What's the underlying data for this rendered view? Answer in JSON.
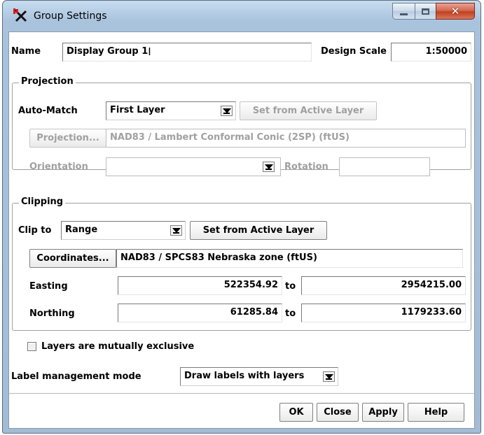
{
  "window": {
    "title": "Group Settings"
  },
  "name_row": {
    "name_label": "Name",
    "name_value": "Display Group 1",
    "design_scale_label": "Design Scale",
    "design_scale_value": "1:50000"
  },
  "projection": {
    "title": "Projection",
    "auto_match_label": "Auto-Match",
    "auto_match_value": "First Layer",
    "set_from_active_label": "Set from Active Layer",
    "projection_button": "Projection...",
    "projection_value": "NAD83 / Lambert Conformal Conic (2SP) (ftUS)",
    "orientation_label": "Orientation",
    "orientation_value": "",
    "rotation_label": "Rotation",
    "rotation_value": ""
  },
  "clipping": {
    "title": "Clipping",
    "clip_to_label": "Clip to",
    "clip_to_value": "Range",
    "set_from_active_label": "Set from Active Layer",
    "coordinates_button": "Coordinates...",
    "coordinates_value": "NAD83 / SPCS83 Nebraska zone (ftUS)",
    "easting_label": "Easting",
    "easting_from": "522354.92",
    "easting_to_label": "to",
    "easting_to": "2954215.00",
    "northing_label": "Northing",
    "northing_from": "61285.84",
    "northing_to_label": "to",
    "northing_to": "1179233.60"
  },
  "options": {
    "mutually_exclusive_label": "Layers are mutually exclusive",
    "mutually_exclusive_checked": false,
    "label_mode_label": "Label management mode",
    "label_mode_value": "Draw labels with layers"
  },
  "buttons": {
    "ok": "OK",
    "close": "Close",
    "apply": "Apply",
    "help": "Help"
  },
  "colors": {
    "disabled_text": "#a0a0a0",
    "title_bar": "#a9c3dd",
    "close_button": "#c2401f"
  }
}
